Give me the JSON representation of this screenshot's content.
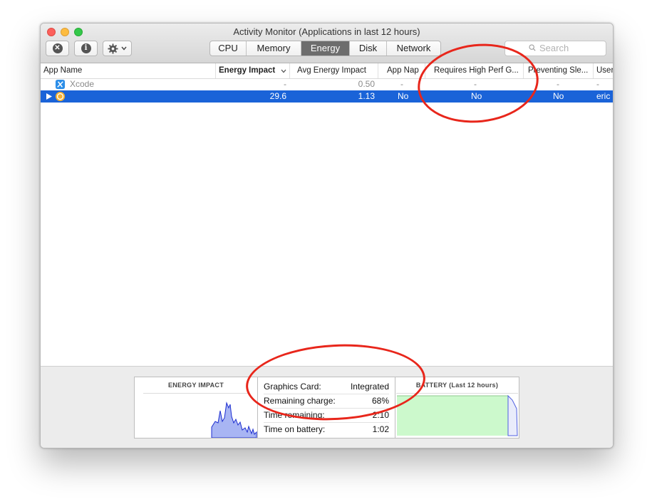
{
  "window": {
    "title": "Activity Monitor (Applications in last 12 hours)"
  },
  "toolbar": {
    "stop_icon": "close-x-icon",
    "info_icon": "info-icon",
    "action_icon": "gear-icon",
    "tabs": [
      {
        "label": "CPU",
        "active": false
      },
      {
        "label": "Memory",
        "active": false
      },
      {
        "label": "Energy",
        "active": true
      },
      {
        "label": "Disk",
        "active": false
      },
      {
        "label": "Network",
        "active": false
      }
    ],
    "search": {
      "placeholder": "Search",
      "value": ""
    }
  },
  "table": {
    "columns": [
      "App Name",
      "Energy Impact",
      "Avg Energy Impact",
      "App Nap",
      "Requires High Perf G...",
      "Preventing Sle...",
      "User"
    ],
    "sort_indicator": "chevron-down-icon",
    "rows": [
      {
        "name": "Xcode",
        "energy": "-",
        "avg": "0.50",
        "nap": "-",
        "high_perf": "-",
        "prevent": "-",
        "user": "-",
        "selected": false
      },
      {
        "name": "",
        "energy": "29.6",
        "avg": "1.13",
        "nap": "No",
        "high_perf": "No",
        "prevent": "No",
        "user": "eric",
        "selected": true
      }
    ]
  },
  "footer": {
    "energy_title": "ENERGY IMPACT",
    "stats": [
      {
        "label": "Graphics Card:",
        "value": "Integrated"
      },
      {
        "label": "Remaining charge:",
        "value": "68%"
      },
      {
        "label": "Time remaining:",
        "value": "2:10"
      },
      {
        "label": "Time on battery:",
        "value": "1:02"
      }
    ],
    "battery_title": "BATTERY (Last 12 hours)",
    "battery_charge": 0.68
  },
  "colors": {
    "selection": "#1a63d8",
    "energy_fill": "#a8b5f3",
    "energy_stroke": "#1c2dd0",
    "battery_fill": "#ccf9cc",
    "annotation": "#e8261b"
  }
}
